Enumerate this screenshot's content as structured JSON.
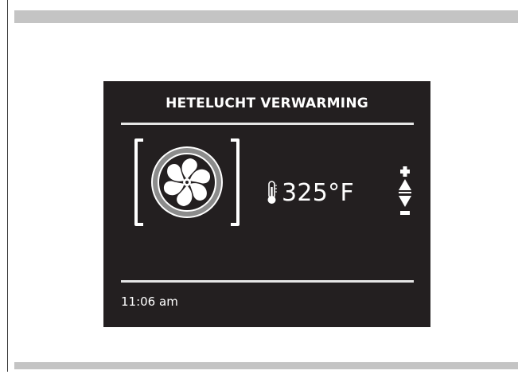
{
  "oven": {
    "mode_title": "HETELUCHT VERWARMING",
    "temperature": "325°F",
    "time": "11:06 am"
  },
  "icons": {
    "mode": "fan-icon",
    "temperature": "thermometer-icon",
    "increase": "plus-icon",
    "decrease": "minus-icon"
  },
  "colors": {
    "screen_background": "#231f20",
    "foreground": "#ffffff",
    "fan_ring": "#8c8c8c",
    "frame_bars": "#c4c4c4"
  }
}
